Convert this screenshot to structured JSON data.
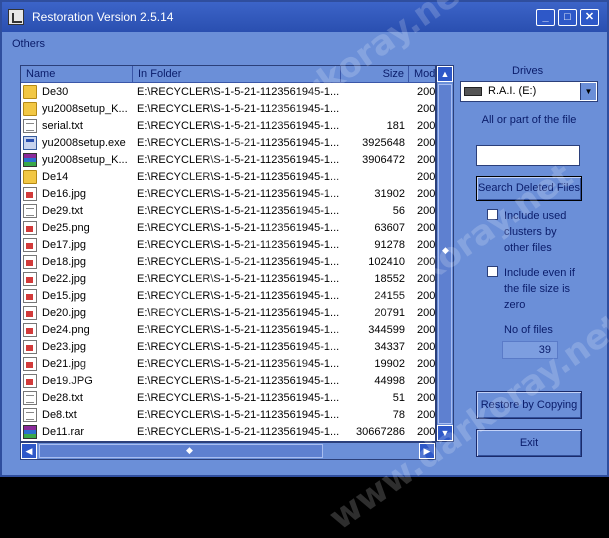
{
  "window": {
    "title": "Restoration Version 2.5.14"
  },
  "menu": {
    "others": "Others"
  },
  "list": {
    "columns": {
      "name": "Name",
      "folder": "In Folder",
      "size": "Size",
      "mod": "Mod"
    },
    "rows": [
      {
        "icon": "folder-icon",
        "name": "De30",
        "folder": "E:\\RECYCLER\\S-1-5-21-1123561945-1...",
        "size": "",
        "mod": "200"
      },
      {
        "icon": "folder-icon",
        "name": "yu2008setup_K...",
        "folder": "E:\\RECYCLER\\S-1-5-21-1123561945-1...",
        "size": "",
        "mod": "200"
      },
      {
        "icon": "text-file-icon",
        "name": "serial.txt",
        "folder": "E:\\RECYCLER\\S-1-5-21-1123561945-1...",
        "size": "181",
        "mod": "200"
      },
      {
        "icon": "exe-file-icon",
        "name": "yu2008setup.exe",
        "folder": "E:\\RECYCLER\\S-1-5-21-1123561945-1...",
        "size": "3925648",
        "mod": "200"
      },
      {
        "icon": "rar-file-icon",
        "name": "yu2008setup_K...",
        "folder": "E:\\RECYCLER\\S-1-5-21-1123561945-1...",
        "size": "3906472",
        "mod": "200"
      },
      {
        "icon": "folder-icon",
        "name": "De14",
        "folder": "E:\\RECYCLER\\S-1-5-21-1123561945-1...",
        "size": "",
        "mod": "200"
      },
      {
        "icon": "image-file-icon",
        "name": "De16.jpg",
        "folder": "E:\\RECYCLER\\S-1-5-21-1123561945-1...",
        "size": "31902",
        "mod": "200"
      },
      {
        "icon": "text-file-icon",
        "name": "De29.txt",
        "folder": "E:\\RECYCLER\\S-1-5-21-1123561945-1...",
        "size": "56",
        "mod": "200"
      },
      {
        "icon": "image-file-icon",
        "name": "De25.png",
        "folder": "E:\\RECYCLER\\S-1-5-21-1123561945-1...",
        "size": "63607",
        "mod": "200"
      },
      {
        "icon": "image-file-icon",
        "name": "De17.jpg",
        "folder": "E:\\RECYCLER\\S-1-5-21-1123561945-1...",
        "size": "91278",
        "mod": "200"
      },
      {
        "icon": "image-file-icon",
        "name": "De18.jpg",
        "folder": "E:\\RECYCLER\\S-1-5-21-1123561945-1...",
        "size": "102410",
        "mod": "200"
      },
      {
        "icon": "image-file-icon",
        "name": "De22.jpg",
        "folder": "E:\\RECYCLER\\S-1-5-21-1123561945-1...",
        "size": "18552",
        "mod": "200"
      },
      {
        "icon": "image-file-icon",
        "name": "De15.jpg",
        "folder": "E:\\RECYCLER\\S-1-5-21-1123561945-1...",
        "size": "24155",
        "mod": "200"
      },
      {
        "icon": "image-file-icon",
        "name": "De20.jpg",
        "folder": "E:\\RECYCLER\\S-1-5-21-1123561945-1...",
        "size": "20791",
        "mod": "200"
      },
      {
        "icon": "image-file-icon",
        "name": "De24.png",
        "folder": "E:\\RECYCLER\\S-1-5-21-1123561945-1...",
        "size": "344599",
        "mod": "200"
      },
      {
        "icon": "image-file-icon",
        "name": "De23.jpg",
        "folder": "E:\\RECYCLER\\S-1-5-21-1123561945-1...",
        "size": "34337",
        "mod": "200"
      },
      {
        "icon": "image-file-icon",
        "name": "De21.jpg",
        "folder": "E:\\RECYCLER\\S-1-5-21-1123561945-1...",
        "size": "19902",
        "mod": "200"
      },
      {
        "icon": "image-file-icon",
        "name": "De19.JPG",
        "folder": "E:\\RECYCLER\\S-1-5-21-1123561945-1...",
        "size": "44998",
        "mod": "200"
      },
      {
        "icon": "text-file-icon",
        "name": "De28.txt",
        "folder": "E:\\RECYCLER\\S-1-5-21-1123561945-1...",
        "size": "51",
        "mod": "200"
      },
      {
        "icon": "text-file-icon",
        "name": "De8.txt",
        "folder": "E:\\RECYCLER\\S-1-5-21-1123561945-1...",
        "size": "78",
        "mod": "200"
      },
      {
        "icon": "rar-file-icon",
        "name": "De11.rar",
        "folder": "E:\\RECYCLER\\S-1-5-21-1123561945-1...",
        "size": "30667286",
        "mod": "200"
      }
    ]
  },
  "panel": {
    "drives_label": "Drives",
    "drive_selected": "R.A.I. (E:)",
    "filename_label": "All or part of the file",
    "filename_value": "",
    "search_button": "Search Deleted Files",
    "include_used_clusters": "Include used clusters by other files",
    "include_zero_size": "Include even if the file size is zero",
    "no_of_files_label": "No of files",
    "no_of_files_value": "39",
    "restore_button": "Restore by Copying",
    "exit_button": "Exit"
  },
  "watermark": "www.darkoray.net",
  "colors": {
    "window_bg": "#6b8fd8",
    "titlebar": "#2a4fb0",
    "text": "#0a1c6a"
  }
}
